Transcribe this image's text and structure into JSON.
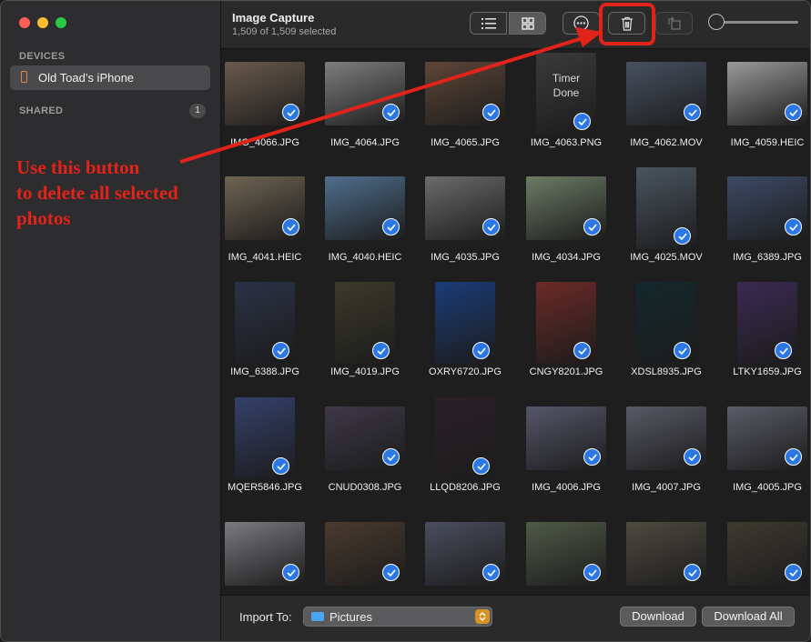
{
  "app": {
    "title": "Image Capture",
    "subtitle": "1,509 of 1,509 selected"
  },
  "sidebar": {
    "devices_header": "DEVICES",
    "device_label": "Old Toad’s iPhone",
    "shared_header": "SHARED",
    "shared_count": "1"
  },
  "toolbar": {
    "icons": [
      "list-view-icon",
      "grid-view-icon",
      "more-options-icon",
      "trash-icon",
      "rotate-icon"
    ],
    "selected_view": "grid"
  },
  "photos": [
    {
      "name": "IMG_4066.JPG",
      "color": "#6a5a4c"
    },
    {
      "name": "IMG_4064.JPG",
      "color": "#7e7e7e"
    },
    {
      "name": "IMG_4065.JPG",
      "color": "#5e4638"
    },
    {
      "name": "IMG_4063.PNG",
      "color": "#3a3a3a",
      "screen_text": "Timer\nDone"
    },
    {
      "name": "IMG_4062.MOV",
      "color": "#475061"
    },
    {
      "name": "IMG_4059.HEIC",
      "color": "#9a9a9a"
    },
    {
      "name": "IMG_4041.HEIC",
      "color": "#6e6452"
    },
    {
      "name": "IMG_4040.HEIC",
      "color": "#4f6f8d"
    },
    {
      "name": "IMG_4035.JPG",
      "color": "#6b6b6b"
    },
    {
      "name": "IMG_4034.JPG",
      "color": "#6d7b66"
    },
    {
      "name": "IMG_4025.MOV",
      "color": "#4a5560"
    },
    {
      "name": "IMG_6389.JPG",
      "color": "#3d4a66"
    },
    {
      "name": "IMG_6388.JPG",
      "color": "#2b3246"
    },
    {
      "name": "IMG_4019.JPG",
      "color": "#3b3a2a"
    },
    {
      "name": "OXRY6720.JPG",
      "color": "#1a3c78"
    },
    {
      "name": "CNGY8201.JPG",
      "color": "#6b2a26"
    },
    {
      "name": "XDSL8935.JPG",
      "color": "#14282c"
    },
    {
      "name": "LTKY1659.JPG",
      "color": "#3a2a52"
    },
    {
      "name": "MQER5846.JPG",
      "color": "#34406a"
    },
    {
      "name": "CNUD0308.JPG",
      "color": "#3e3848"
    },
    {
      "name": "LLQD8206.JPG",
      "color": "#2a2028"
    },
    {
      "name": "IMG_4006.JPG",
      "color": "#56566a"
    },
    {
      "name": "IMG_4007.JPG",
      "color": "#585a66"
    },
    {
      "name": "IMG_4005.JPG",
      "color": "#5a5c68"
    },
    {
      "name": "",
      "color": "#7a7a80"
    },
    {
      "name": "",
      "color": "#4a3a2e"
    },
    {
      "name": "",
      "color": "#4a4e5e"
    },
    {
      "name": "",
      "color": "#4f5a48"
    },
    {
      "name": "",
      "color": "#4e4a40"
    },
    {
      "name": "",
      "color": "#3e3a30"
    }
  ],
  "footer": {
    "import_label": "Import To:",
    "import_value": "Pictures",
    "download_label": "Download",
    "download_all_label": "Download All"
  },
  "annotation": {
    "line1": "Use this button",
    "line2": "to delete all selected",
    "line3": "photos",
    "color": "#e2231a"
  }
}
